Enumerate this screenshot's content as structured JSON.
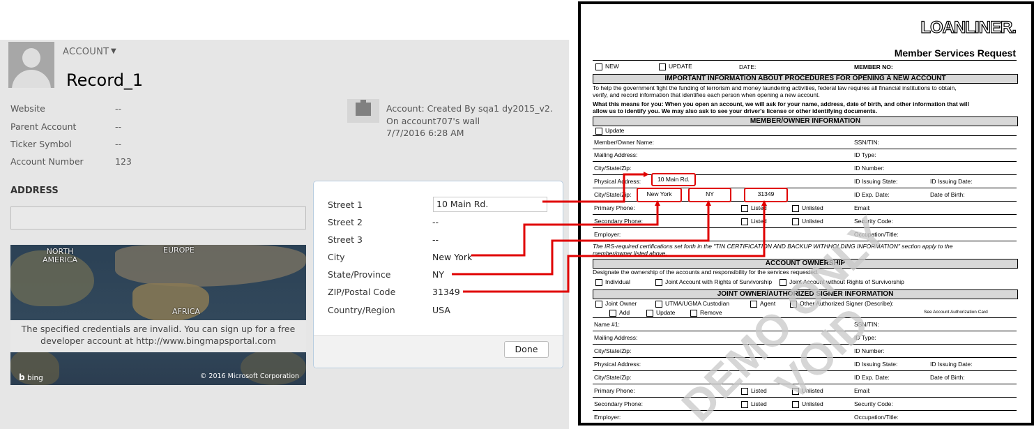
{
  "crm": {
    "entity_menu": "ACCOUNT",
    "record_name": "Record_1",
    "fields": [
      {
        "label": "Website",
        "value": "--"
      },
      {
        "label": "Parent Account",
        "value": "--"
      },
      {
        "label": "Ticker Symbol",
        "value": "--"
      },
      {
        "label": "Account Number",
        "value": "123"
      }
    ],
    "activity": {
      "line1": "Account: Created By sqa1 dy2015_v2.",
      "line2": "On account707's wall",
      "line3": "7/7/2016 6:28 AM"
    },
    "address_heading": "ADDRESS",
    "map": {
      "labels": [
        "NORTH",
        "AMERICA",
        "EUROPE",
        "AFRICA"
      ],
      "message_line1": "The specified credentials are invalid. You can sign up for a free",
      "message_line2": "developer account at http://www.bingmapsportal.com",
      "brand": "bing",
      "copyright": "© 2016 Microsoft Corporation"
    },
    "address_popup": {
      "rows": [
        {
          "label": "Street 1",
          "value": "10 Main Rd."
        },
        {
          "label": "Street 2",
          "value": "--"
        },
        {
          "label": "Street 3",
          "value": "--"
        },
        {
          "label": "City",
          "value": "New York"
        },
        {
          "label": "State/Province",
          "value": "NY"
        },
        {
          "label": "ZIP/Postal Code",
          "value": "31349"
        },
        {
          "label": "Country/Region",
          "value": "USA"
        }
      ],
      "done_label": "Done"
    }
  },
  "form": {
    "logo": "LOANLINER.",
    "title": "Member Services Request",
    "new_label": "NEW",
    "update_label": "UPDATE",
    "date_label": "DATE:",
    "member_no_label": "MEMBER NO:",
    "section1": "IMPORTANT INFORMATION ABOUT PROCEDURES FOR OPENING A NEW ACCOUNT",
    "intro_line1": "To help the government fight the funding of terrorism and money laundering activities, federal law requires all financial institutions to obtain,",
    "intro_line2": "verify, and record information that identifies each person when opening a new account.",
    "intro_line3": "What this means for you: When you open an account, we will ask for your name, address, date of birth, and other information that will",
    "intro_line4": "allow us to identify you. We may also ask to see your driver's license or other identifying documents.",
    "section2": "MEMBER/OWNER INFORMATION",
    "update_cb": "Update",
    "owner_rows": [
      {
        "left": "Member/Owner Name:",
        "right": "SSN/TIN:"
      },
      {
        "left": "Mailing Address:",
        "right": "ID Type:"
      },
      {
        "left": "City/State/Zip:",
        "right": "ID Number:"
      },
      {
        "left": "Physical Address:",
        "right": "ID Issuing State:",
        "right2": "ID Issuing Date:"
      },
      {
        "left": "City/State/Zip:",
        "right": "ID Exp. Date:",
        "right2": "Date of Birth:"
      },
      {
        "left": "Primary Phone:",
        "listed": "Listed",
        "unlisted": "Unlisted",
        "right": "Email:"
      },
      {
        "left": "Secondary Phone:",
        "listed": "Listed",
        "unlisted": "Unlisted",
        "right": "Security Code:"
      },
      {
        "left": "Employer:",
        "right": "Occupation/Title:"
      }
    ],
    "irs_line1": "The IRS-required certifications set forth in the \"TIN CERTIFICATION AND BACKUP WITHHOLDING INFORMATION\" section apply to the",
    "irs_line2": "member/owner listed above.",
    "section3": "ACCOUNT OWNERSHIP",
    "ownership_text": "Designate the ownership of the accounts and responsibility for the services requested.",
    "ownership_opts": [
      "Individual",
      "Joint Account with Rights of Survivorship",
      "Joint Account without Rights of Survivorship"
    ],
    "section4": "JOINT OWNER/AUTHORIZED SIGNER INFORMATION",
    "joint_opts": [
      "Joint Owner",
      "UTMA/UGMA Custodian",
      "Agent",
      "Other Authorized Signer (Describe):"
    ],
    "joint_opts2": [
      "Add",
      "Update",
      "Remove"
    ],
    "see_card": "See Account Authorization Card",
    "joint_rows": [
      {
        "left": "Name #1:",
        "right": "SSN/TIN:"
      },
      {
        "left": "Mailing Address:",
        "right": "ID Type:"
      },
      {
        "left": "City/State/Zip:",
        "right": "ID Number:"
      },
      {
        "left": "Physical Address:",
        "right": "ID Issuing State:",
        "right2": "ID Issuing Date:"
      },
      {
        "left": "City/State/Zip:",
        "right": "ID Exp. Date:",
        "right2": "Date of Birth:"
      },
      {
        "left": "Primary Phone:",
        "listed": "Listed",
        "unlisted": "Unlisted",
        "right": "Email:"
      },
      {
        "left": "Secondary Phone:",
        "listed": "Listed",
        "unlisted": "Unlisted",
        "right": "Security Code:"
      },
      {
        "left": "Employer:",
        "right": "Occupation/Title:"
      }
    ],
    "filled": {
      "physical_address": "10 Main Rd.",
      "city": "New York",
      "state": "NY",
      "zip": "31349"
    },
    "watermark1": "DEMO ONLY",
    "watermark2": "VOID"
  },
  "colors": {
    "arrow": "#e00000",
    "popup_border": "#b8cde0"
  }
}
